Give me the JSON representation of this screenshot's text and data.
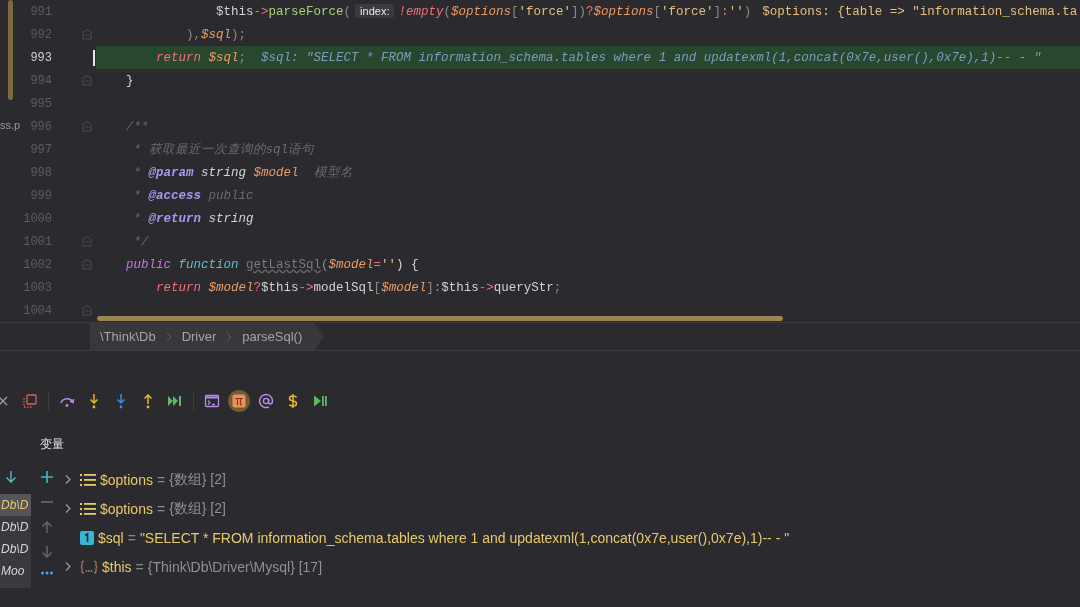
{
  "editor": {
    "side_fragment": "ss.p",
    "lines": [
      {
        "number": "991",
        "current": false,
        "fold": false,
        "tokens": [
          {
            "t": "                $this",
            "kind": "plain"
          },
          {
            "t": "->",
            "kind": "op"
          },
          {
            "t": "parseForce",
            "kind": "fn"
          },
          {
            "t": "(",
            "kind": "punct"
          },
          {
            "t": "index:",
            "kind": "badge"
          },
          {
            "t": "!empty",
            "kind": "kw"
          },
          {
            "t": "(",
            "kind": "punct"
          },
          {
            "t": "$options",
            "kind": "var"
          },
          {
            "t": "[",
            "kind": "punct"
          },
          {
            "t": "'force'",
            "kind": "str"
          },
          {
            "t": "])",
            "kind": "punct"
          },
          {
            "t": "?",
            "kind": "op"
          },
          {
            "t": "$options",
            "kind": "var"
          },
          {
            "t": "[",
            "kind": "punct"
          },
          {
            "t": "'force'",
            "kind": "str"
          },
          {
            "t": "]",
            "kind": "punct"
          },
          {
            "t": ":",
            "kind": "op"
          },
          {
            "t": "''",
            "kind": "str"
          },
          {
            "t": ")",
            "kind": "punct"
          },
          {
            "t": "$options: {table => \"information_schema.ta",
            "kind": "hint"
          }
        ]
      },
      {
        "number": "992",
        "current": false,
        "fold": true,
        "tokens": [
          {
            "t": "            ),",
            "kind": "punct"
          },
          {
            "t": "$sql",
            "kind": "var"
          },
          {
            "t": ");",
            "kind": "punct"
          }
        ]
      },
      {
        "number": "993",
        "current": true,
        "fold": false,
        "tokens": [
          {
            "t": "        return ",
            "kind": "kw"
          },
          {
            "t": "$sql",
            "kind": "var"
          },
          {
            "t": ";",
            "kind": "punct"
          },
          {
            "t": "$sql: \"SELECT * FROM information_schema.tables where 1 and updatexml(1,concat(0x7e,user(),0x7e),1)-- - \"",
            "kind": "inlay"
          }
        ]
      },
      {
        "number": "994",
        "current": false,
        "fold": true,
        "tokens": [
          {
            "t": "    }",
            "kind": "plain"
          }
        ]
      },
      {
        "number": "995",
        "current": false,
        "fold": false
      },
      {
        "number": "996",
        "current": false,
        "fold": true,
        "tokens": [
          {
            "t": "    /**",
            "kind": "comment"
          }
        ]
      },
      {
        "number": "997",
        "current": false,
        "fold": false,
        "tokens": [
          {
            "t": "     * 获取最近一次查询的sql语句",
            "kind": "comment"
          }
        ]
      },
      {
        "number": "998",
        "current": false,
        "fold": false,
        "tokens": [
          {
            "t": "     * ",
            "kind": "comment"
          },
          {
            "t": "@param",
            "kind": "doctag"
          },
          {
            "t": " string ",
            "kind": "doctype"
          },
          {
            "t": "$model",
            "kind": "var"
          },
          {
            "t": "  模型名",
            "kind": "comment"
          }
        ]
      },
      {
        "number": "999",
        "current": false,
        "fold": false,
        "tokens": [
          {
            "t": "     * ",
            "kind": "comment"
          },
          {
            "t": "@access",
            "kind": "doctag"
          },
          {
            "t": " public",
            "kind": "comment"
          }
        ]
      },
      {
        "number": "1000",
        "current": false,
        "fold": false,
        "tokens": [
          {
            "t": "     * ",
            "kind": "comment"
          },
          {
            "t": "@return",
            "kind": "doctag"
          },
          {
            "t": " string",
            "kind": "doctype"
          }
        ]
      },
      {
        "number": "1001",
        "current": false,
        "fold": true,
        "tokens": [
          {
            "t": "     */",
            "kind": "comment"
          }
        ]
      },
      {
        "number": "1002",
        "current": false,
        "fold": true,
        "tokens": [
          {
            "t": "    public ",
            "kind": "mod"
          },
          {
            "t": "function ",
            "kind": "func"
          },
          {
            "t": "getLastSql",
            "kind": "unused"
          },
          {
            "t": "(",
            "kind": "punct"
          },
          {
            "t": "$model",
            "kind": "var"
          },
          {
            "t": "=",
            "kind": "op"
          },
          {
            "t": "''",
            "kind": "str"
          },
          {
            "t": ") {",
            "kind": "plain"
          }
        ]
      },
      {
        "number": "1003",
        "current": false,
        "fold": false,
        "tokens": [
          {
            "t": "        return ",
            "kind": "kw"
          },
          {
            "t": "$model",
            "kind": "var"
          },
          {
            "t": "?",
            "kind": "op"
          },
          {
            "t": "$this",
            "kind": "plain"
          },
          {
            "t": "->",
            "kind": "op"
          },
          {
            "t": "modelSql",
            "kind": "plain"
          },
          {
            "t": "[",
            "kind": "punct"
          },
          {
            "t": "$model",
            "kind": "var"
          },
          {
            "t": "]",
            "kind": "punct"
          },
          {
            "t": ":",
            "kind": "op"
          },
          {
            "t": "$this",
            "kind": "plain"
          },
          {
            "t": "->",
            "kind": "op"
          },
          {
            "t": "queryStr",
            "kind": "plain"
          },
          {
            "t": ";",
            "kind": "punct"
          }
        ]
      },
      {
        "number": "1004",
        "current": false,
        "fold": true
      }
    ]
  },
  "breadcrumbs": [
    "\\Think\\Db",
    "Driver",
    "parseSql()"
  ],
  "toolbar_groups": [
    {
      "buttons": [
        {
          "kind": "close",
          "selected": false
        },
        {
          "kind": "restore",
          "selected": false
        }
      ]
    },
    {
      "buttons": [
        {
          "kind": "step-over",
          "selected": false
        },
        {
          "kind": "step-into",
          "selected": false
        },
        {
          "kind": "force-step-into",
          "selected": false
        },
        {
          "kind": "step-out",
          "selected": false
        },
        {
          "kind": "run-to-cursor",
          "selected": false
        }
      ]
    },
    {
      "buttons": [
        {
          "kind": "console",
          "selected": false
        },
        {
          "kind": "evaluate",
          "selected": true
        },
        {
          "kind": "watch",
          "selected": false
        },
        {
          "kind": "variable",
          "selected": false
        },
        {
          "kind": "resume",
          "selected": false
        }
      ]
    }
  ],
  "variables_label": "变量",
  "frames": [
    {
      "text": "Db\\D",
      "selected": true
    },
    {
      "text": "Db\\D",
      "selected": false
    },
    {
      "text": "Db\\D",
      "selected": false
    },
    {
      "text": "Moo",
      "selected": false
    }
  ],
  "variables": [
    {
      "kind": "array",
      "expanded": false,
      "name": "$options",
      "sep": "=",
      "value": "{数组} [2]"
    },
    {
      "kind": "array",
      "expanded": false,
      "name": "$options",
      "sep": "=",
      "value": "{数组} [2]"
    },
    {
      "kind": "scalar",
      "name": "$sql",
      "sep": "=",
      "value": "\"SELECT * FROM information_schema.tables where 1 and updatexml(1,concat(0x7e,user(),0x7e),1)-- - \""
    },
    {
      "kind": "object",
      "expanded": false,
      "name": "$this",
      "sep": "=",
      "value": "{Think\\Db\\Driver\\Mysql} [17]"
    }
  ]
}
